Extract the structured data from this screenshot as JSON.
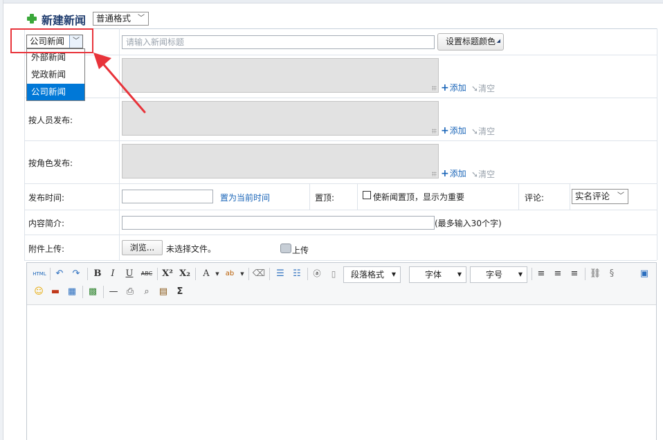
{
  "header": {
    "title": "新建新闻",
    "format_select": "普通格式"
  },
  "form": {
    "category_select": "公司新闻",
    "category_options": [
      "外部新闻",
      "党政新闻",
      "公司新闻"
    ],
    "title_placeholder": "请输入新闻标题",
    "title_color_button": "设置标题颜色",
    "publish_by_person_label": "按人员发布:",
    "publish_by_role_label": "按角色发布:",
    "add_label": "添加",
    "clear_label": "清空",
    "publish_time_label": "发布时间:",
    "set_now_link": "置为当前时间",
    "pin_label": "置顶:",
    "pin_checkbox_label": "使新闻置顶，显示为重要",
    "comment_label": "评论:",
    "comment_select": "实名评论",
    "summary_label": "内容简介:",
    "summary_hint": "(最多输入30个字)",
    "attachment_label": "附件上传:",
    "browse_button": "浏览...",
    "no_file_text": "未选择文件。",
    "upload_label": "上传"
  },
  "editor": {
    "paragraph_format": "段落格式",
    "font_family": "字体",
    "font_size": "字号",
    "html_label": "HTML"
  },
  "colors": {
    "accent_blue": "#1a65b8",
    "highlight_red": "#e8333a",
    "selected_option": "#0078d7"
  }
}
